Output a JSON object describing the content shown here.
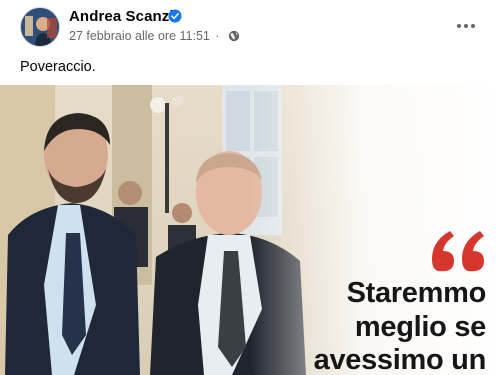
{
  "post": {
    "author": "Andrea Scanzi",
    "date": "27 febbraio alle ore 11:51",
    "separator": "·",
    "text": "Poveraccio.",
    "icons": {
      "verified": "verified-badge-icon",
      "privacy": "globe-icon",
      "more": "more-options-icon"
    },
    "colors": {
      "verified": "#1877f2",
      "meta": "#65676b",
      "quote_accent": "#d6372d"
    }
  },
  "image": {
    "quote_mark": "“",
    "lines": [
      "Staremmo",
      "meglio se",
      "avessimo un"
    ]
  }
}
